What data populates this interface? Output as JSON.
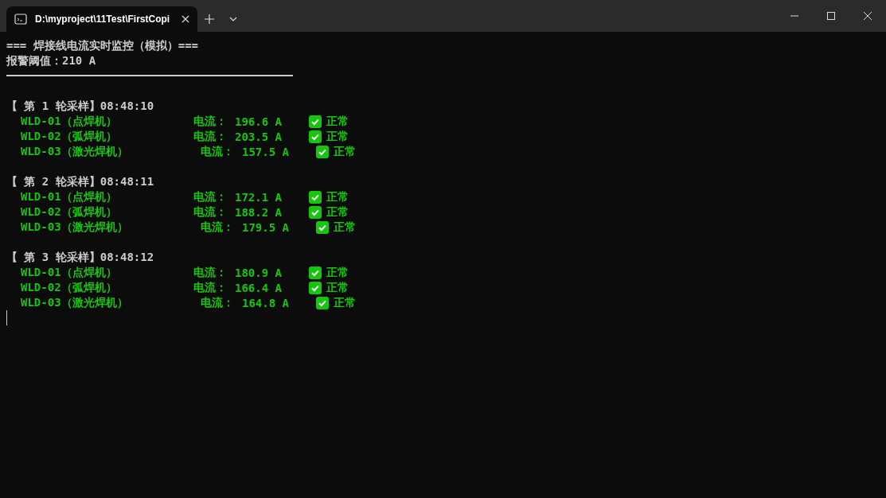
{
  "tab": {
    "title": "D:\\myproject\\11Test\\FirstCopi",
    "selected": true
  },
  "console": {
    "title": "=== 焊接线电流实时监控（模拟）===",
    "threshold": "报警阈值：210 A",
    "rounds": [
      {
        "header": "【 第 1 轮采样】08:48:10",
        "rows": [
          {
            "name": "WLD-01（点焊机）",
            "label": "电流：",
            "value": "196.6 A",
            "ok": true,
            "status": "正常"
          },
          {
            "name": "WLD-02（弧焊机）",
            "label": "电流：",
            "value": "203.5 A",
            "ok": true,
            "status": "正常"
          },
          {
            "name": "WLD-03（激光焊机）",
            "label": "电流：",
            "value": "157.5 A",
            "ok": true,
            "status": "正常"
          }
        ]
      },
      {
        "header": "【 第 2 轮采样】08:48:11",
        "rows": [
          {
            "name": "WLD-01（点焊机）",
            "label": "电流：",
            "value": "172.1 A",
            "ok": true,
            "status": "正常"
          },
          {
            "name": "WLD-02（弧焊机）",
            "label": "电流：",
            "value": "188.2 A",
            "ok": true,
            "status": "正常"
          },
          {
            "name": "WLD-03（激光焊机）",
            "label": "电流：",
            "value": "179.5 A",
            "ok": true,
            "status": "正常"
          }
        ]
      },
      {
        "header": "【 第 3 轮采样】08:48:12",
        "rows": [
          {
            "name": "WLD-01（点焊机）",
            "label": "电流：",
            "value": "180.9 A",
            "ok": true,
            "status": "正常"
          },
          {
            "name": "WLD-02（弧焊机）",
            "label": "电流：",
            "value": "166.4 A",
            "ok": true,
            "status": "正常"
          },
          {
            "name": "WLD-03（激光焊机）",
            "label": "电流：",
            "value": "164.8 A",
            "ok": true,
            "status": "正常"
          }
        ]
      }
    ]
  }
}
